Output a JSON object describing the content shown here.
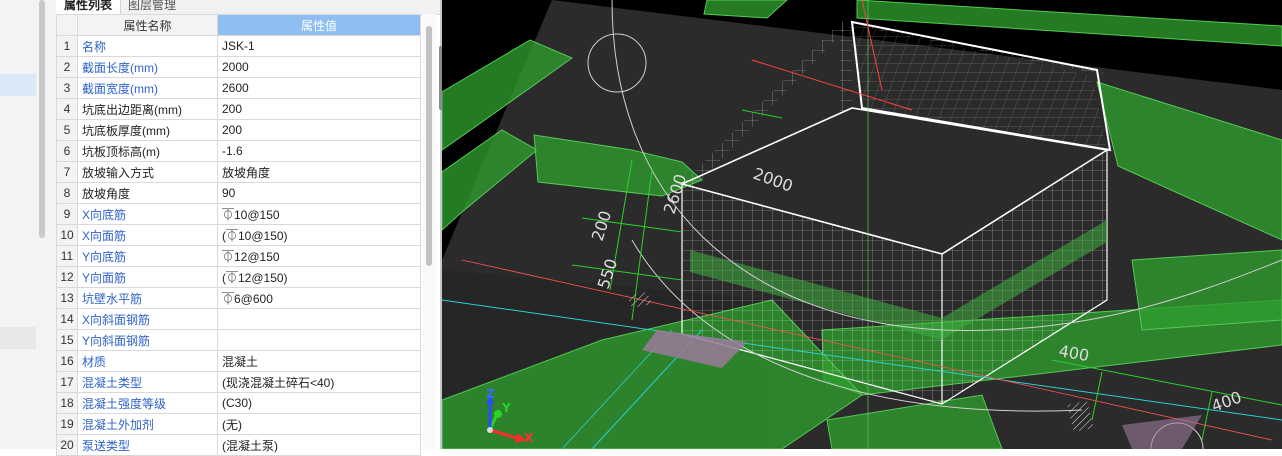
{
  "tabs": [
    {
      "label": "属性列表",
      "active": true
    },
    {
      "label": "图层管理",
      "active": false
    }
  ],
  "table": {
    "headers": [
      "",
      "属性名称",
      "属性值"
    ],
    "rows": [
      {
        "n": "1",
        "k": "名称",
        "v": "JSK-1",
        "blue": true
      },
      {
        "n": "2",
        "k": "截面长度(mm)",
        "v": "2000",
        "blue": true
      },
      {
        "n": "3",
        "k": "截面宽度(mm)",
        "v": "2600",
        "blue": true
      },
      {
        "n": "4",
        "k": "坑底出边距离(mm)",
        "v": "200",
        "blue": false
      },
      {
        "n": "5",
        "k": "坑底板厚度(mm)",
        "v": "200",
        "blue": false
      },
      {
        "n": "6",
        "k": "坑板顶标高(m)",
        "v": "-1.6",
        "blue": false
      },
      {
        "n": "7",
        "k": "放坡输入方式",
        "v": "放坡角度",
        "blue": false
      },
      {
        "n": "8",
        "k": "放坡角度",
        "v": "90",
        "blue": false
      },
      {
        "n": "9",
        "k": "X向底筋",
        "v": "⏁10@150",
        "blue": true
      },
      {
        "n": "10",
        "k": "X向面筋",
        "v": "(⏁10@150)",
        "blue": true
      },
      {
        "n": "11",
        "k": "Y向底筋",
        "v": "⏁12@150",
        "blue": true
      },
      {
        "n": "12",
        "k": "Y向面筋",
        "v": "(⏁12@150)",
        "blue": true
      },
      {
        "n": "13",
        "k": "坑壁水平筋",
        "v": "⏁6@600",
        "blue": true
      },
      {
        "n": "14",
        "k": "X向斜面钢筋",
        "v": "",
        "blue": true
      },
      {
        "n": "15",
        "k": "Y向斜面钢筋",
        "v": "",
        "blue": true
      },
      {
        "n": "16",
        "k": "材质",
        "v": "混凝土",
        "blue": true
      },
      {
        "n": "17",
        "k": "混凝土类型",
        "v": "(现浇混凝土碎石<40)",
        "blue": true
      },
      {
        "n": "18",
        "k": "混凝土强度等级",
        "v": "(C30)",
        "blue": true
      },
      {
        "n": "19",
        "k": "混凝土外加剂",
        "v": "(无)",
        "blue": true
      },
      {
        "n": "20",
        "k": "泵送类型",
        "v": "(混凝土泵)",
        "blue": true
      }
    ]
  },
  "viewport": {
    "dimensions": [
      "2000",
      "2600",
      "200",
      "550",
      "400",
      "400"
    ],
    "axes": {
      "x": "X",
      "y": "Y",
      "z": "Z"
    },
    "colors": {
      "background": "#000000",
      "beam": "#2e9e2e",
      "rebar": "#e8e8e8",
      "dimension": "#2ad12a",
      "slab": "#2c2c2c"
    }
  }
}
